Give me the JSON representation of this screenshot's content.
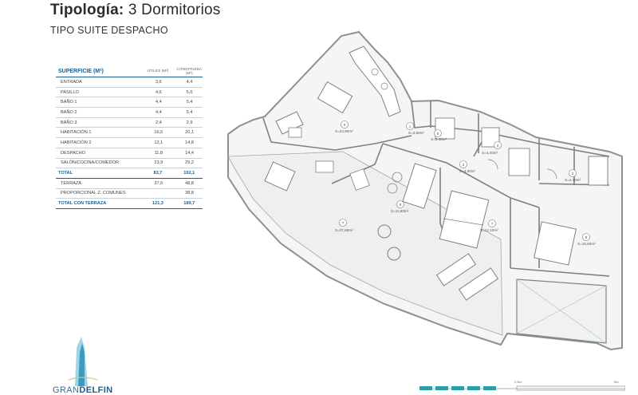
{
  "header": {
    "title_bold": "Tipología:",
    "title_rest": "3 Dormitorios",
    "subtitle": "TIPO SUITE DESPACHO"
  },
  "table": {
    "header": {
      "name": "SUPERFICIE (M²)",
      "utiles": "ÚTILES (M²)",
      "construida": "CONSTRUIDA (M²)"
    },
    "rows": [
      {
        "name": "ENTRADA",
        "utiles": "3,6",
        "construida": "4,4"
      },
      {
        "name": "PASILLO",
        "utiles": "4,6",
        "construida": "5,6"
      },
      {
        "name": "BAÑO 1",
        "utiles": "4,4",
        "construida": "5,4"
      },
      {
        "name": "BAÑO 2",
        "utiles": "4,4",
        "construida": "5,4"
      },
      {
        "name": "BAÑO 3",
        "utiles": "2,4",
        "construida": "2,9"
      },
      {
        "name": "HABITACIÓN 1",
        "utiles": "16,5",
        "construida": "20,1"
      },
      {
        "name": "HABITACIÓN 2",
        "utiles": "12,1",
        "construida": "14,8"
      },
      {
        "name": "DESPACHO",
        "utiles": "11,8",
        "construida": "14,4"
      },
      {
        "name": "SALÓN/COCINA/COMEDOR",
        "utiles": "23,9",
        "construida": "29,2"
      }
    ],
    "total": {
      "name": "TOTAL",
      "utiles": "83,7",
      "construida": "102,1"
    },
    "extra_rows": [
      {
        "name": "TERRAZA",
        "utiles": "37,6",
        "construida": "48,8"
      },
      {
        "name": "PROPORCIONAL Z. COMUNES",
        "utiles": "",
        "construida": "38,8"
      }
    ],
    "grand_total": {
      "name": "TOTAL CON TERRAZA",
      "utiles": "121,3",
      "construida": "189,7"
    }
  },
  "rooms": [
    {
      "num": "1",
      "area": "S=3,60m²"
    },
    {
      "num": "2",
      "area": "S=4,60m²"
    },
    {
      "num": "3",
      "area": "S=4,40m²"
    },
    {
      "num": "4",
      "area": "S=4,40m²"
    },
    {
      "num": "5",
      "area": "S=2,40m²"
    },
    {
      "num": "6",
      "area": "S=16,50m²"
    },
    {
      "num": "7",
      "area": "S=12,10m²"
    },
    {
      "num": "8",
      "area": "S=11,80m²"
    },
    {
      "num": "9",
      "area": "S=23,90m²"
    },
    {
      "num": "T",
      "area": "S=37,60m²"
    }
  ],
  "logo": {
    "part1": "GRAN",
    "part2": "DELFIN"
  },
  "scale": {
    "mid": "2,5m",
    "end": "5m"
  },
  "colors": {
    "accent": "#1d5f8a",
    "plan_fill": "#eef0ef",
    "plan_line": "#8c9290",
    "scale_teal": "#2a9fa8"
  }
}
